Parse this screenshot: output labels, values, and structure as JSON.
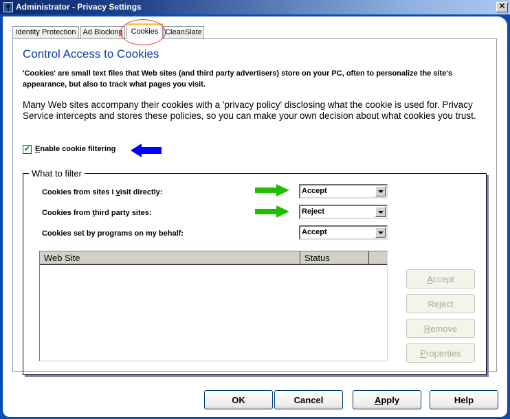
{
  "window": {
    "title": "Administrator - Privacy Settings",
    "icon": "keyhole-icon",
    "close_label": "✕"
  },
  "tabs": [
    {
      "label": "Identity Protection",
      "active": false
    },
    {
      "label": "Ad Blocking",
      "active": false
    },
    {
      "label": "Cookies",
      "active": true
    },
    {
      "label": "CleanSlate",
      "active": false
    }
  ],
  "main": {
    "heading": "Control Access to Cookies",
    "paragraph1": "'Cookies' are small text files that Web sites (and third party advertisers) store on your PC, often to personalize the site's appearance, but also to track what pages you visit.",
    "paragraph2": "Many Web sites accompany their cookies with a 'privacy policy' disclosing what the cookie is used for. Privacy Service intercepts and stores these policies, so you can make your own decision about what cookies you trust.",
    "enable_filtering": {
      "label_prefix": "",
      "label_mnemonic": "E",
      "label_rest": "nable cookie filtering",
      "checked": true
    }
  },
  "filter": {
    "legend": "What to filter",
    "rows": [
      {
        "label_a": "Cookies from sites I ",
        "mnemonic": "v",
        "label_b": "isit directly:",
        "value": "Accept"
      },
      {
        "label_a": "Cookies from ",
        "mnemonic": "t",
        "label_b": "hird party sites:",
        "value": "Reject"
      },
      {
        "label_a": "Cookies set by programs on my behalf:",
        "mnemonic": "",
        "label_b": "",
        "value": "Accept"
      }
    ],
    "list": {
      "columns": [
        "Web Site",
        "Status",
        ""
      ],
      "rows": []
    },
    "side_buttons": [
      {
        "mnemonic": "A",
        "rest": "ccept",
        "enabled": false
      },
      {
        "mnemonic": "",
        "rest": "Reject",
        "enabled": false
      },
      {
        "mnemonic": "R",
        "rest": "emove",
        "enabled": false
      },
      {
        "mnemonic": "P",
        "rest": "roperties",
        "enabled": false
      }
    ]
  },
  "footer": {
    "ok": "OK",
    "cancel": "Cancel",
    "apply_mnemonic": "A",
    "apply_rest": "pply",
    "help": "Help"
  },
  "annotations": {
    "blue_arrow_color": "#0000ff",
    "green_arrow_color": "#1fbf00",
    "circle_color": "#e33333"
  }
}
